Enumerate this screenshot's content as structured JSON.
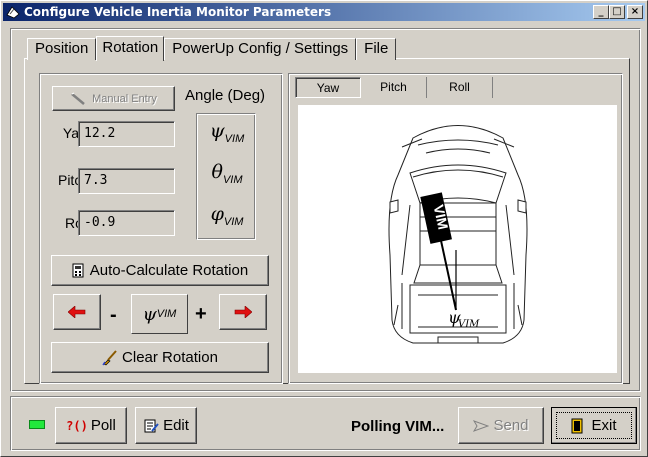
{
  "window": {
    "title": "Configure Vehicle Inertia Monitor Parameters",
    "controls": [
      "_",
      "□",
      "×"
    ]
  },
  "tabs": [
    {
      "label": "Position",
      "active": false
    },
    {
      "label": "Rotation",
      "active": true
    },
    {
      "label": "PowerUp Config / Settings",
      "active": false
    },
    {
      "label": "File",
      "active": false
    }
  ],
  "rotation": {
    "manual_entry_label": "Manual Entry",
    "angle_header": "Angle (Deg)",
    "fields": [
      {
        "label": "Yaw:",
        "value": "12.2",
        "symbol": "ψ",
        "sub": "VIM"
      },
      {
        "label": "Pitch:",
        "value": "7.3",
        "symbol": "θ",
        "sub": "VIM"
      },
      {
        "label": "Roll:",
        "value": "-0.9",
        "symbol": "φ",
        "sub": "VIM"
      }
    ],
    "auto_calc_label": "Auto-Calculate Rotation",
    "minus": "-",
    "plus": "+",
    "adjust_symbol": "ψ",
    "adjust_sub": "VIM",
    "clear_label": "Clear Rotation"
  },
  "view": {
    "tabs": [
      {
        "label": "Yaw",
        "active": true
      },
      {
        "label": "Pitch",
        "active": false
      },
      {
        "label": "Roll",
        "active": false
      }
    ],
    "device_label": "VIM",
    "angle_symbol": "ψ",
    "angle_sub": "VIM",
    "yaw_deg": 12.2
  },
  "bottom": {
    "poll_icon": "?()",
    "poll_label": "Poll",
    "edit_label": "Edit",
    "status": "Polling VIM...",
    "send_label": "Send",
    "exit_label": "Exit"
  },
  "colors": {
    "title_start": "#0a246a",
    "title_end": "#a6caf0",
    "face": "#d4d0c8",
    "led": "#22e83c",
    "arrow": "#c00000"
  }
}
